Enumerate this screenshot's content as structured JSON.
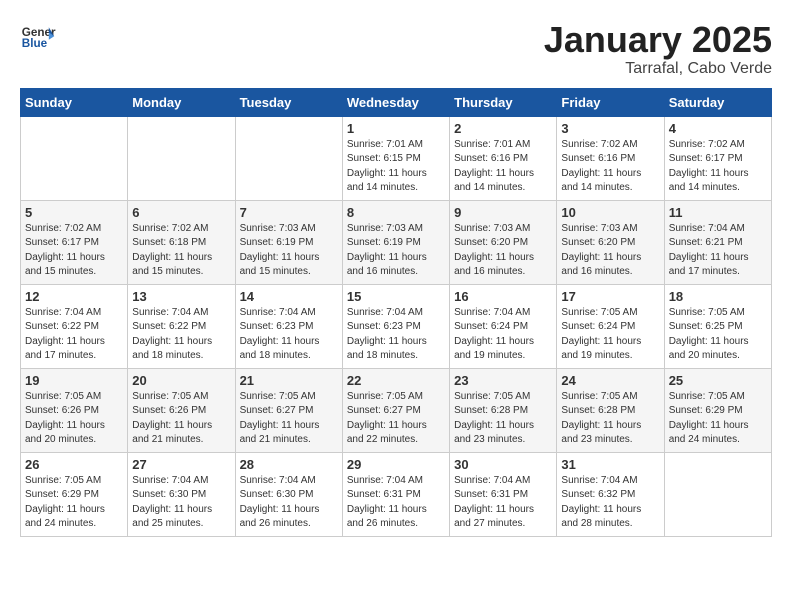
{
  "logo": {
    "general": "General",
    "blue": "Blue"
  },
  "title": "January 2025",
  "subtitle": "Tarrafal, Cabo Verde",
  "weekdays": [
    "Sunday",
    "Monday",
    "Tuesday",
    "Wednesday",
    "Thursday",
    "Friday",
    "Saturday"
  ],
  "weeks": [
    [
      {
        "day": "",
        "info": ""
      },
      {
        "day": "",
        "info": ""
      },
      {
        "day": "",
        "info": ""
      },
      {
        "day": "1",
        "info": "Sunrise: 7:01 AM\nSunset: 6:15 PM\nDaylight: 11 hours\nand 14 minutes."
      },
      {
        "day": "2",
        "info": "Sunrise: 7:01 AM\nSunset: 6:16 PM\nDaylight: 11 hours\nand 14 minutes."
      },
      {
        "day": "3",
        "info": "Sunrise: 7:02 AM\nSunset: 6:16 PM\nDaylight: 11 hours\nand 14 minutes."
      },
      {
        "day": "4",
        "info": "Sunrise: 7:02 AM\nSunset: 6:17 PM\nDaylight: 11 hours\nand 14 minutes."
      }
    ],
    [
      {
        "day": "5",
        "info": "Sunrise: 7:02 AM\nSunset: 6:17 PM\nDaylight: 11 hours\nand 15 minutes."
      },
      {
        "day": "6",
        "info": "Sunrise: 7:02 AM\nSunset: 6:18 PM\nDaylight: 11 hours\nand 15 minutes."
      },
      {
        "day": "7",
        "info": "Sunrise: 7:03 AM\nSunset: 6:19 PM\nDaylight: 11 hours\nand 15 minutes."
      },
      {
        "day": "8",
        "info": "Sunrise: 7:03 AM\nSunset: 6:19 PM\nDaylight: 11 hours\nand 16 minutes."
      },
      {
        "day": "9",
        "info": "Sunrise: 7:03 AM\nSunset: 6:20 PM\nDaylight: 11 hours\nand 16 minutes."
      },
      {
        "day": "10",
        "info": "Sunrise: 7:03 AM\nSunset: 6:20 PM\nDaylight: 11 hours\nand 16 minutes."
      },
      {
        "day": "11",
        "info": "Sunrise: 7:04 AM\nSunset: 6:21 PM\nDaylight: 11 hours\nand 17 minutes."
      }
    ],
    [
      {
        "day": "12",
        "info": "Sunrise: 7:04 AM\nSunset: 6:22 PM\nDaylight: 11 hours\nand 17 minutes."
      },
      {
        "day": "13",
        "info": "Sunrise: 7:04 AM\nSunset: 6:22 PM\nDaylight: 11 hours\nand 18 minutes."
      },
      {
        "day": "14",
        "info": "Sunrise: 7:04 AM\nSunset: 6:23 PM\nDaylight: 11 hours\nand 18 minutes."
      },
      {
        "day": "15",
        "info": "Sunrise: 7:04 AM\nSunset: 6:23 PM\nDaylight: 11 hours\nand 18 minutes."
      },
      {
        "day": "16",
        "info": "Sunrise: 7:04 AM\nSunset: 6:24 PM\nDaylight: 11 hours\nand 19 minutes."
      },
      {
        "day": "17",
        "info": "Sunrise: 7:05 AM\nSunset: 6:24 PM\nDaylight: 11 hours\nand 19 minutes."
      },
      {
        "day": "18",
        "info": "Sunrise: 7:05 AM\nSunset: 6:25 PM\nDaylight: 11 hours\nand 20 minutes."
      }
    ],
    [
      {
        "day": "19",
        "info": "Sunrise: 7:05 AM\nSunset: 6:26 PM\nDaylight: 11 hours\nand 20 minutes."
      },
      {
        "day": "20",
        "info": "Sunrise: 7:05 AM\nSunset: 6:26 PM\nDaylight: 11 hours\nand 21 minutes."
      },
      {
        "day": "21",
        "info": "Sunrise: 7:05 AM\nSunset: 6:27 PM\nDaylight: 11 hours\nand 21 minutes."
      },
      {
        "day": "22",
        "info": "Sunrise: 7:05 AM\nSunset: 6:27 PM\nDaylight: 11 hours\nand 22 minutes."
      },
      {
        "day": "23",
        "info": "Sunrise: 7:05 AM\nSunset: 6:28 PM\nDaylight: 11 hours\nand 23 minutes."
      },
      {
        "day": "24",
        "info": "Sunrise: 7:05 AM\nSunset: 6:28 PM\nDaylight: 11 hours\nand 23 minutes."
      },
      {
        "day": "25",
        "info": "Sunrise: 7:05 AM\nSunset: 6:29 PM\nDaylight: 11 hours\nand 24 minutes."
      }
    ],
    [
      {
        "day": "26",
        "info": "Sunrise: 7:05 AM\nSunset: 6:29 PM\nDaylight: 11 hours\nand 24 minutes."
      },
      {
        "day": "27",
        "info": "Sunrise: 7:04 AM\nSunset: 6:30 PM\nDaylight: 11 hours\nand 25 minutes."
      },
      {
        "day": "28",
        "info": "Sunrise: 7:04 AM\nSunset: 6:30 PM\nDaylight: 11 hours\nand 26 minutes."
      },
      {
        "day": "29",
        "info": "Sunrise: 7:04 AM\nSunset: 6:31 PM\nDaylight: 11 hours\nand 26 minutes."
      },
      {
        "day": "30",
        "info": "Sunrise: 7:04 AM\nSunset: 6:31 PM\nDaylight: 11 hours\nand 27 minutes."
      },
      {
        "day": "31",
        "info": "Sunrise: 7:04 AM\nSunset: 6:32 PM\nDaylight: 11 hours\nand 28 minutes."
      },
      {
        "day": "",
        "info": ""
      }
    ]
  ]
}
